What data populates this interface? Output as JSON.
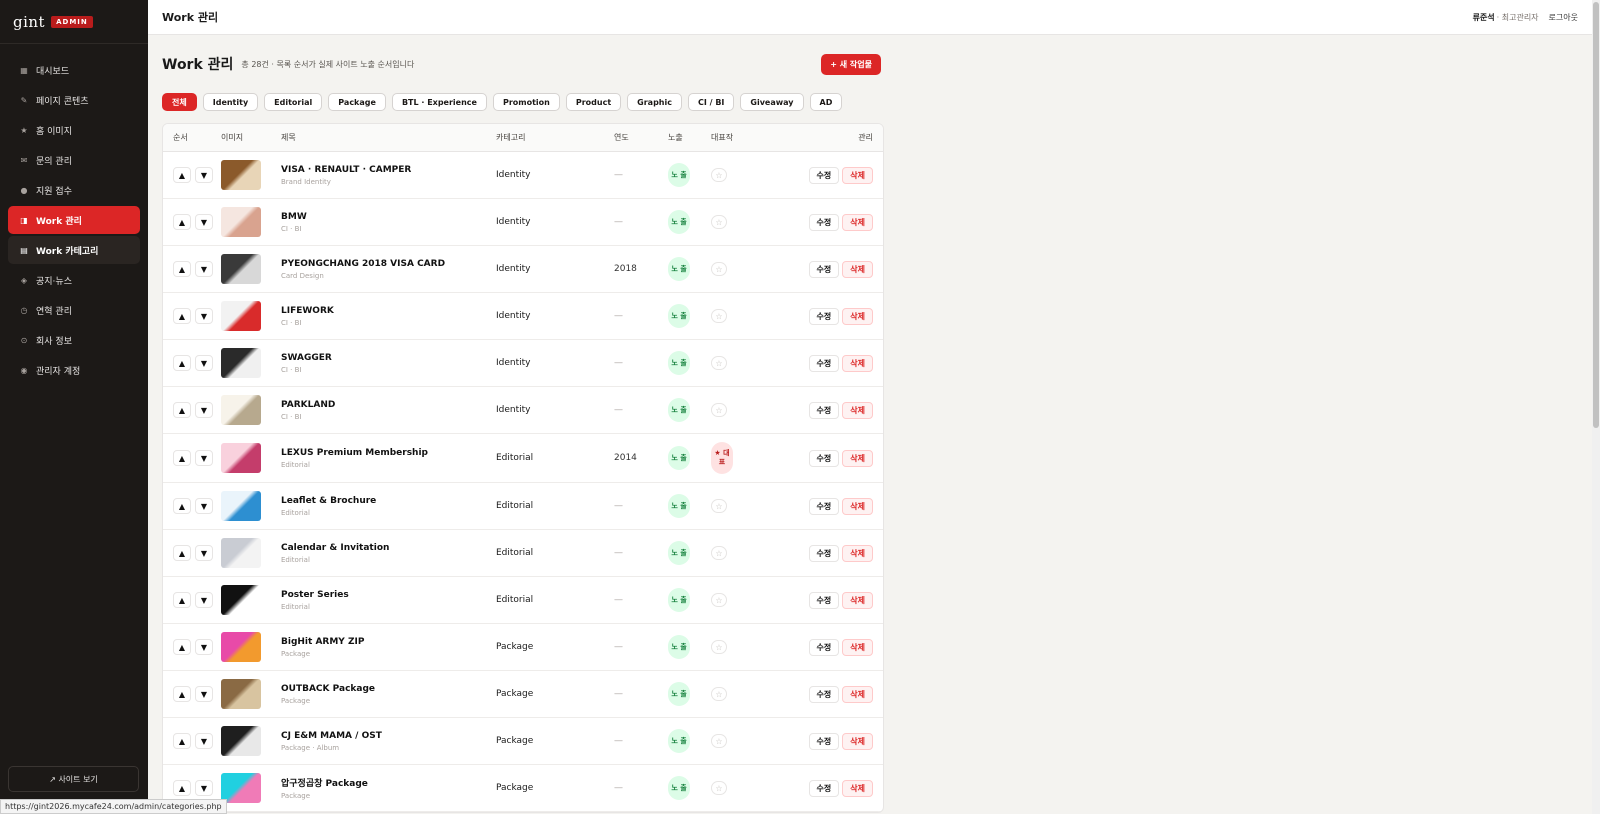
{
  "brand": {
    "logo": "gint",
    "badge": "ADMIN"
  },
  "sidebar": {
    "items": [
      {
        "label": "대시보드",
        "icon": "▦"
      },
      {
        "label": "페이지 콘텐츠",
        "icon": "✎"
      },
      {
        "label": "홈 이미지",
        "icon": "★"
      },
      {
        "label": "문의 관리",
        "icon": "✉"
      },
      {
        "label": "지원 접수",
        "icon": "●"
      },
      {
        "label": "Work 관리",
        "icon": "◨"
      },
      {
        "label": "Work 카테고리",
        "icon": "▤"
      },
      {
        "label": "공지·뉴스",
        "icon": "◈"
      },
      {
        "label": "연혁 관리",
        "icon": "◷"
      },
      {
        "label": "회사 정보",
        "icon": "⊙"
      },
      {
        "label": "관리자 계정",
        "icon": "◉"
      }
    ],
    "site_link": "↗ 사이트 보기"
  },
  "status_url": "https://gint2026.mycafe24.com/admin/categories.php",
  "topbar": {
    "title": "Work 관리",
    "user": "류준석",
    "role": "· 최고관리자",
    "logout": "로그아웃"
  },
  "main": {
    "title": "Work 관리",
    "desc": "총 28건 · 목록 순서가 실제 사이트 노출 순서입니다",
    "new_button": "+ 새 작업물"
  },
  "filters": [
    "전체",
    "Identity",
    "Editorial",
    "Package",
    "BTL · Experience",
    "Promotion",
    "Product",
    "Graphic",
    "CI / BI",
    "Giveaway",
    "AD"
  ],
  "columns": {
    "order": "순서",
    "image": "이미지",
    "title": "제목",
    "category": "카테고리",
    "year": "연도",
    "exposure": "노출",
    "featured": "대표작",
    "manage": "관리"
  },
  "labels": {
    "up": "▲",
    "down": "▼",
    "exposed": "노 출",
    "star": "☆",
    "featured": "★ 대 표",
    "edit": "수정",
    "delete": "삭제"
  },
  "rows": [
    {
      "title": "VISA · RENAULT · CAMPER",
      "sub": "Brand Identity",
      "category": "Identity",
      "year": "—",
      "featured": false,
      "thumb": [
        "#8b5a2b",
        "#e8d5b7"
      ]
    },
    {
      "title": "BMW",
      "sub": "CI · BI",
      "category": "Identity",
      "year": "—",
      "featured": false,
      "thumb": [
        "#f5e6e0",
        "#d9a38f"
      ]
    },
    {
      "title": "PYEONGCHANG 2018 VISA CARD",
      "sub": "Card Design",
      "category": "Identity",
      "year": "2018",
      "featured": false,
      "thumb": [
        "#3a3a3a",
        "#d8d8d8"
      ]
    },
    {
      "title": "LIFEWORK",
      "sub": "CI · BI",
      "category": "Identity",
      "year": "—",
      "featured": false,
      "thumb": [
        "#f2f2f2",
        "#d92b2b"
      ]
    },
    {
      "title": "SWAGGER",
      "sub": "CI · BI",
      "category": "Identity",
      "year": "—",
      "featured": false,
      "thumb": [
        "#2a2a2a",
        "#f0f0f0"
      ]
    },
    {
      "title": "PARKLAND",
      "sub": "CI · BI",
      "category": "Identity",
      "year": "—",
      "featured": false,
      "thumb": [
        "#f7f3ea",
        "#b7a98e"
      ]
    },
    {
      "title": "LEXUS Premium Membership",
      "sub": "Editorial",
      "category": "Editorial",
      "year": "2014",
      "featured": true,
      "thumb": [
        "#f9d1dd",
        "#c43d6b"
      ]
    },
    {
      "title": "Leaflet & Brochure",
      "sub": "Editorial",
      "category": "Editorial",
      "year": "—",
      "featured": false,
      "thumb": [
        "#eaf4fb",
        "#2d8fd1"
      ]
    },
    {
      "title": "Calendar & Invitation",
      "sub": "Editorial",
      "category": "Editorial",
      "year": "—",
      "featured": false,
      "thumb": [
        "#c9ccd3",
        "#f3f3f3"
      ]
    },
    {
      "title": "Poster Series",
      "sub": "Editorial",
      "category": "Editorial",
      "year": "—",
      "featured": false,
      "thumb": [
        "#111111",
        "#ffffff"
      ]
    },
    {
      "title": "BigHit ARMY ZIP",
      "sub": "Package",
      "category": "Package",
      "year": "—",
      "featured": false,
      "thumb": [
        "#e84aa8",
        "#f29a2e"
      ]
    },
    {
      "title": "OUTBACK Package",
      "sub": "Package",
      "category": "Package",
      "year": "—",
      "featured": false,
      "thumb": [
        "#8a6a44",
        "#d8c4a0"
      ]
    },
    {
      "title": "CJ E&M MAMA / OST",
      "sub": "Package · Album",
      "category": "Package",
      "year": "—",
      "featured": false,
      "thumb": [
        "#1f1f1f",
        "#e8e8e8"
      ]
    },
    {
      "title": "압구정곱창 Package",
      "sub": "Package",
      "category": "Package",
      "year": "—",
      "featured": false,
      "thumb": [
        "#21d0e0",
        "#f07bb7"
      ]
    }
  ]
}
